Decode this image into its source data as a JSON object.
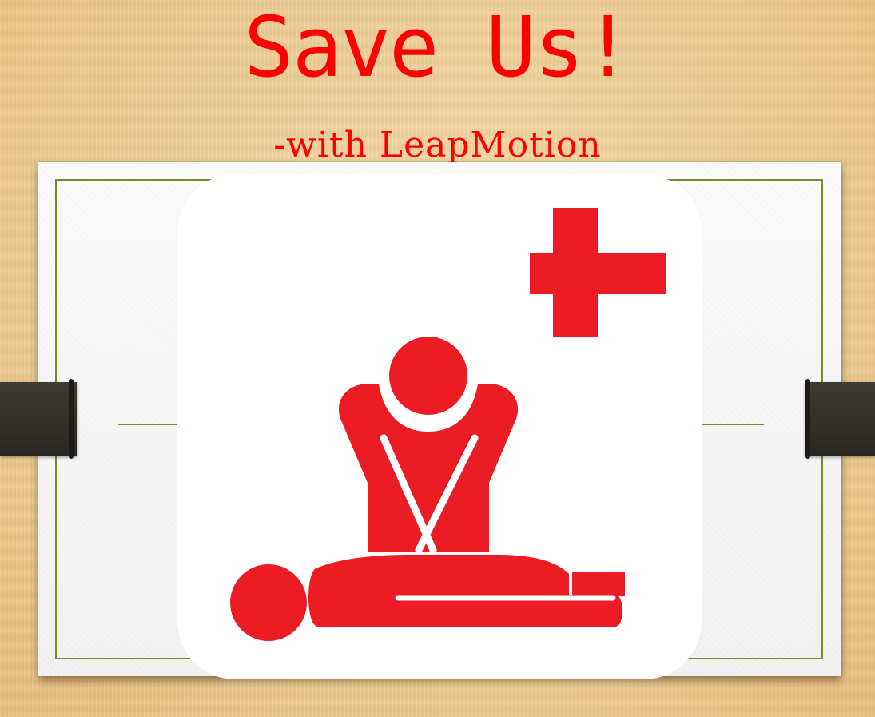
{
  "slide": {
    "title": "Save Us!",
    "subtitle": "-with LeapMotion",
    "icon": "cpr-first-aid-icon",
    "colors": {
      "title": "#ff0000",
      "icon_red": "#ec1c24",
      "frame": "#7a8a2a",
      "strap": "#2f2b26"
    }
  }
}
